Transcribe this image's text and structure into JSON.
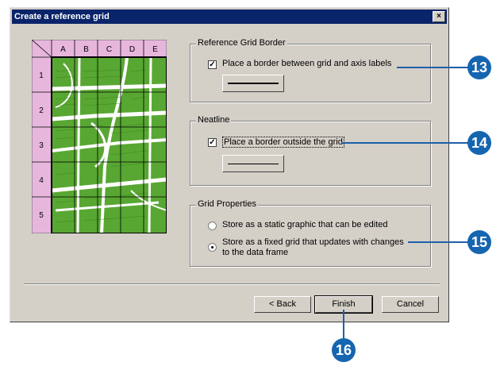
{
  "dialog": {
    "title": "Create a reference grid",
    "close_symbol": "×"
  },
  "preview": {
    "columns": [
      "A",
      "B",
      "C",
      "D",
      "E"
    ],
    "rows": [
      "1",
      "2",
      "3",
      "4",
      "5"
    ],
    "colors": {
      "label_bg": "#e7b6dd",
      "map_bg": "#58a732",
      "road": "#ffffff"
    }
  },
  "reference_grid_border": {
    "legend": "Reference Grid Border",
    "checkbox_label": "Place a border between grid and axis labels",
    "checked": true
  },
  "neatline": {
    "legend": "Neatline",
    "checkbox_label": "Place a border outside the grid",
    "checked": true
  },
  "grid_properties": {
    "legend": "Grid Properties",
    "option_static": "Store as a static graphic that can be edited",
    "option_fixed_line1": "Store as a fixed grid that updates with changes",
    "option_fixed_line2": "to the data frame",
    "selected": "fixed"
  },
  "buttons": {
    "back": "< Back",
    "finish": "Finish",
    "cancel": "Cancel"
  },
  "callouts": {
    "c13": "13",
    "c14": "14",
    "c15": "15",
    "c16": "16",
    "color": "#1565b0"
  }
}
